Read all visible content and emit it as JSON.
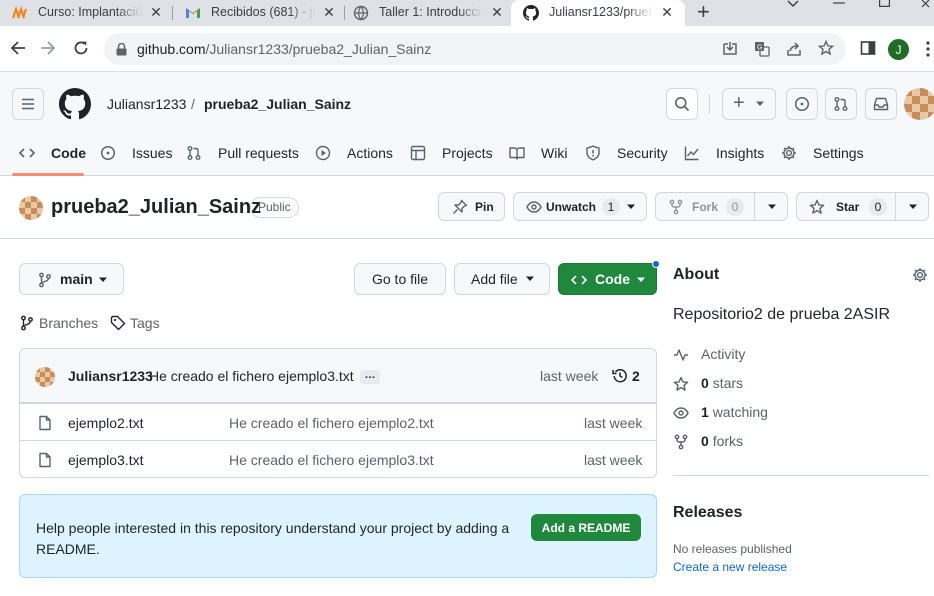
{
  "browser": {
    "tabs": [
      {
        "title": "Curso: Implantación",
        "icon": "moodle-icon"
      },
      {
        "title": "Recibidos (681) - ju",
        "icon": "gmail-icon"
      },
      {
        "title": "Taller 1: Introducció",
        "icon": "globe-icon"
      },
      {
        "title": "Juliansr1233/prueb",
        "icon": "github-icon",
        "active": true
      }
    ],
    "close_glyph": "✕",
    "new_tab_glyph": "+",
    "url_host": "github.com",
    "url_path": "/Juliansr1233/prueba2_Julian_Sainz",
    "profile_initial": "J"
  },
  "header": {
    "owner": "Juliansr1233",
    "separator": "/",
    "repo": "prueba2_Julian_Sainz",
    "plus_glyph": "+"
  },
  "nav": {
    "items": [
      "Code",
      "Issues",
      "Pull requests",
      "Actions",
      "Projects",
      "Wiki",
      "Security",
      "Insights",
      "Settings"
    ],
    "active": "Code"
  },
  "repo": {
    "name": "prueba2_Julian_Sainz",
    "visibility": "Public",
    "pin_label": "Pin",
    "watch_label": "Unwatch",
    "watch_count": "1",
    "fork_label": "Fork",
    "fork_count": "0",
    "star_label": "Star",
    "star_count": "0"
  },
  "toolbar": {
    "branch": "main",
    "go_to_file": "Go to file",
    "add_file": "Add file",
    "code": "Code",
    "branches": "Branches",
    "tags": "Tags"
  },
  "latest_commit": {
    "author": "Juliansr1233",
    "message": "He creado el fichero ejemplo3.txt",
    "ellipsis": "…",
    "time": "last week",
    "count": "2"
  },
  "files": [
    {
      "name": "ejemplo2.txt",
      "message": "He creado el fichero ejemplo2.txt",
      "time": "last week"
    },
    {
      "name": "ejemplo3.txt",
      "message": "He creado el fichero ejemplo3.txt",
      "time": "last week"
    }
  ],
  "readme_prompt": {
    "text": "Help people interested in this repository understand your project by adding a README.",
    "button": "Add a README"
  },
  "about": {
    "title": "About",
    "description": "Repositorio2 de prueba 2ASIR",
    "activity": "Activity",
    "stars_count": "0",
    "stars_label": "stars",
    "watching_count": "1",
    "watching_label": "watching",
    "forks_count": "0",
    "forks_label": "forks"
  },
  "releases": {
    "title": "Releases",
    "none": "No releases published",
    "create": "Create a new release"
  },
  "colors": {
    "accent_green": "#1f883d",
    "link_blue": "#0969da",
    "nav_underline": "#fd8c73",
    "readme_bg": "#ddf4ff",
    "notification_dot": "#0969da"
  }
}
